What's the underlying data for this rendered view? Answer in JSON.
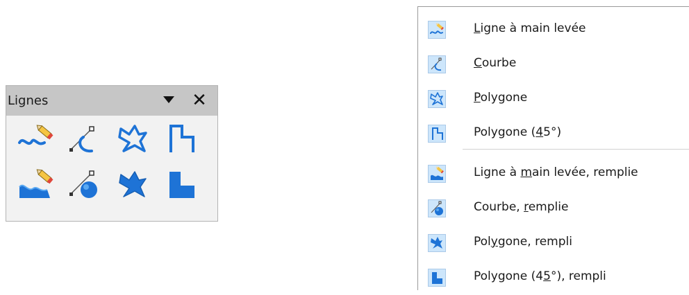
{
  "colors": {
    "icon_blue": "#1e73d6",
    "icon_blue_light": "#5aa9f2",
    "icon_highlight_bg": "#cde6fb",
    "toolbar_header_bg": "#c6c6c6",
    "pencil_yellow": "#f5c542",
    "pencil_red": "#e0463b"
  },
  "toolbar": {
    "title": "Lignes",
    "menu_icon": "chevron-down-icon",
    "close_label": "✕",
    "rows": [
      [
        {
          "name": "freeform-line-icon"
        },
        {
          "name": "curve-icon"
        },
        {
          "name": "polygon-icon"
        },
        {
          "name": "polygon-45-icon"
        }
      ],
      [
        {
          "name": "freeform-line-filled-icon"
        },
        {
          "name": "curve-filled-icon"
        },
        {
          "name": "polygon-filled-icon"
        },
        {
          "name": "polygon-45-filled-icon"
        }
      ]
    ]
  },
  "menu": {
    "items": [
      {
        "pre": "",
        "u": "L",
        "post": "igne à main levée",
        "icon": "freeform-line-icon"
      },
      {
        "pre": "",
        "u": "C",
        "post": "ourbe",
        "icon": "curve-icon"
      },
      {
        "pre": "",
        "u": "P",
        "post": "olygone",
        "icon": "polygon-icon"
      },
      {
        "pre": "Polygone (",
        "u": "4",
        "post": "5°)",
        "icon": "polygon-45-icon"
      },
      {
        "pre": "Ligne à ",
        "u": "m",
        "post": "ain levée, remplie",
        "icon": "freeform-line-filled-icon"
      },
      {
        "pre": "Courbe, ",
        "u": "r",
        "post": "emplie",
        "icon": "curve-filled-icon"
      },
      {
        "pre": "Pol",
        "u": "y",
        "post": "gone, rempli",
        "icon": "polygon-filled-icon"
      },
      {
        "pre": "Polygone (4",
        "u": "5",
        "post": "°), rempli",
        "icon": "polygon-45-filled-icon"
      }
    ]
  }
}
